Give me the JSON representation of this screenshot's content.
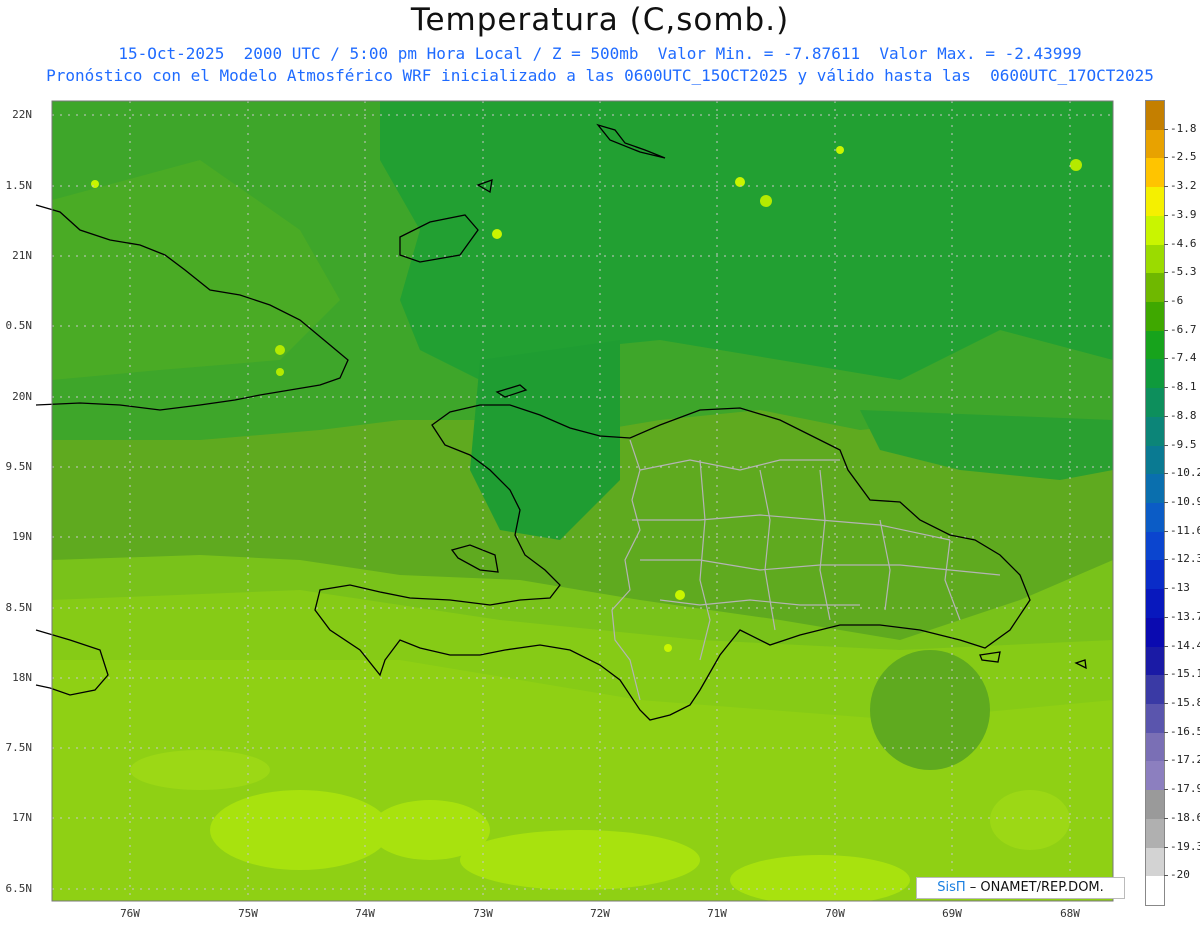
{
  "title": "Temperatura (C,somb.)",
  "subtitle_line1": "15-Oct-2025  2000 UTC / 5:00 pm Hora Local / Z = 500mb  Valor Min. = -7.87611  Valor Max. = -2.43999",
  "subtitle_line2": "Pronóstico con el Modelo Atmosférico WRF inicializado a las 0600UTC_15OCT2025 y válido hasta las  0600UTC_17OCT2025",
  "y_axis_labels": [
    "22N",
    "1.5N",
    "21N",
    "0.5N",
    "20N",
    "9.5N",
    "19N",
    "8.5N",
    "18N",
    "7.5N",
    "17N",
    "6.5N"
  ],
  "x_axis_labels": [
    "76W",
    "75W",
    "74W",
    "73W",
    "72W",
    "71W",
    "70W",
    "69W",
    "68W"
  ],
  "colorbar": {
    "labels": [
      "-1.8",
      "-2.5",
      "-3.2",
      "-3.9",
      "-4.6",
      "-5.3",
      "-6",
      "-6.7",
      "-7.4",
      "-8.1",
      "-8.8",
      "-9.5",
      "-10.2",
      "-10.9",
      "-11.6",
      "-12.3",
      "-13",
      "-13.7",
      "-14.4",
      "-15.1",
      "-15.8",
      "-16.5",
      "-17.2",
      "-17.9",
      "-18.6",
      "-19.3",
      "-20"
    ],
    "colors": [
      "#c47f00",
      "#e8a200",
      "#ffc400",
      "#f5f000",
      "#c9f500",
      "#9bdb00",
      "#6fb800",
      "#3fa800",
      "#17a31c",
      "#0f9a3c",
      "#0d8f5c",
      "#0c8578",
      "#0a7a92",
      "#0a6fae",
      "#0b5cc6",
      "#0b45cf",
      "#0a2cc8",
      "#0818bd",
      "#0a0ab0",
      "#1a1aa5",
      "#3a3aa5",
      "#5a55ad",
      "#7a6fb5",
      "#8c7fbf",
      "#9a9a9a",
      "#b0b0b0",
      "#d3d3d3",
      "#ffffff"
    ]
  },
  "credit": {
    "brand": "SisΠ",
    "text": " – ONAMET/REP.DOM."
  },
  "colors": {
    "field_green": "#5faa1f",
    "field_darkgreen": "#22a228",
    "field_lightgreen": "#9cd815",
    "grid": "#c8c8c8",
    "coast": "#000000",
    "provinces": "#b4b4b4"
  }
}
